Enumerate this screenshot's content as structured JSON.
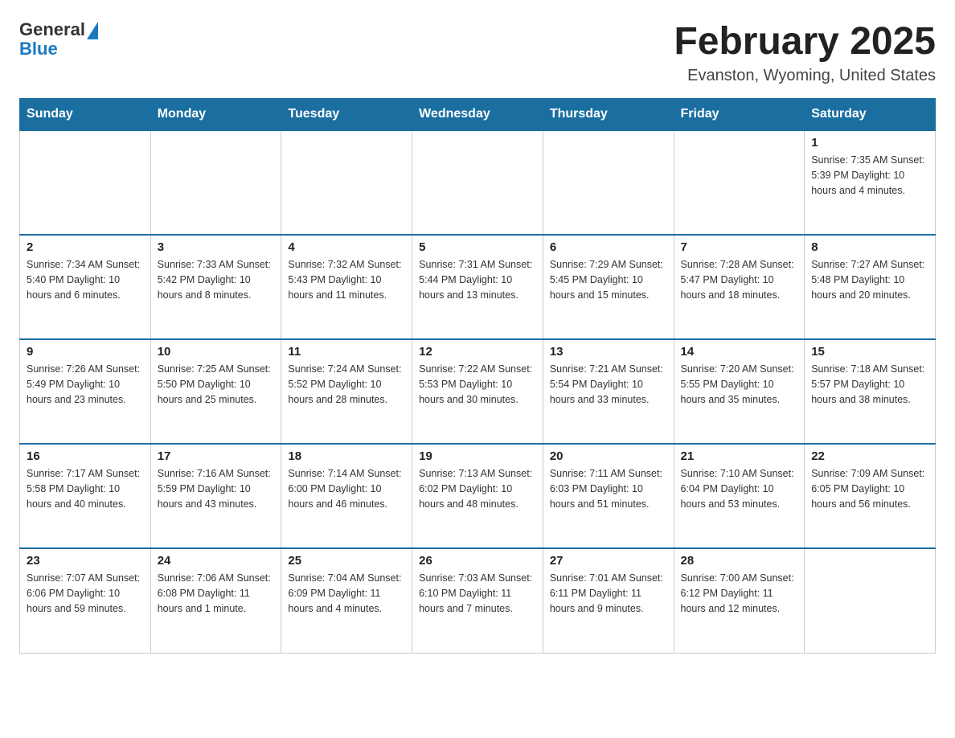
{
  "header": {
    "logo_general": "General",
    "logo_blue": "Blue",
    "title": "February 2025",
    "subtitle": "Evanston, Wyoming, United States"
  },
  "calendar": {
    "days_of_week": [
      "Sunday",
      "Monday",
      "Tuesday",
      "Wednesday",
      "Thursday",
      "Friday",
      "Saturday"
    ],
    "weeks": [
      [
        {
          "day": null,
          "info": null
        },
        {
          "day": null,
          "info": null
        },
        {
          "day": null,
          "info": null
        },
        {
          "day": null,
          "info": null
        },
        {
          "day": null,
          "info": null
        },
        {
          "day": null,
          "info": null
        },
        {
          "day": "1",
          "info": "Sunrise: 7:35 AM\nSunset: 5:39 PM\nDaylight: 10 hours and 4 minutes."
        }
      ],
      [
        {
          "day": "2",
          "info": "Sunrise: 7:34 AM\nSunset: 5:40 PM\nDaylight: 10 hours and 6 minutes."
        },
        {
          "day": "3",
          "info": "Sunrise: 7:33 AM\nSunset: 5:42 PM\nDaylight: 10 hours and 8 minutes."
        },
        {
          "day": "4",
          "info": "Sunrise: 7:32 AM\nSunset: 5:43 PM\nDaylight: 10 hours and 11 minutes."
        },
        {
          "day": "5",
          "info": "Sunrise: 7:31 AM\nSunset: 5:44 PM\nDaylight: 10 hours and 13 minutes."
        },
        {
          "day": "6",
          "info": "Sunrise: 7:29 AM\nSunset: 5:45 PM\nDaylight: 10 hours and 15 minutes."
        },
        {
          "day": "7",
          "info": "Sunrise: 7:28 AM\nSunset: 5:47 PM\nDaylight: 10 hours and 18 minutes."
        },
        {
          "day": "8",
          "info": "Sunrise: 7:27 AM\nSunset: 5:48 PM\nDaylight: 10 hours and 20 minutes."
        }
      ],
      [
        {
          "day": "9",
          "info": "Sunrise: 7:26 AM\nSunset: 5:49 PM\nDaylight: 10 hours and 23 minutes."
        },
        {
          "day": "10",
          "info": "Sunrise: 7:25 AM\nSunset: 5:50 PM\nDaylight: 10 hours and 25 minutes."
        },
        {
          "day": "11",
          "info": "Sunrise: 7:24 AM\nSunset: 5:52 PM\nDaylight: 10 hours and 28 minutes."
        },
        {
          "day": "12",
          "info": "Sunrise: 7:22 AM\nSunset: 5:53 PM\nDaylight: 10 hours and 30 minutes."
        },
        {
          "day": "13",
          "info": "Sunrise: 7:21 AM\nSunset: 5:54 PM\nDaylight: 10 hours and 33 minutes."
        },
        {
          "day": "14",
          "info": "Sunrise: 7:20 AM\nSunset: 5:55 PM\nDaylight: 10 hours and 35 minutes."
        },
        {
          "day": "15",
          "info": "Sunrise: 7:18 AM\nSunset: 5:57 PM\nDaylight: 10 hours and 38 minutes."
        }
      ],
      [
        {
          "day": "16",
          "info": "Sunrise: 7:17 AM\nSunset: 5:58 PM\nDaylight: 10 hours and 40 minutes."
        },
        {
          "day": "17",
          "info": "Sunrise: 7:16 AM\nSunset: 5:59 PM\nDaylight: 10 hours and 43 minutes."
        },
        {
          "day": "18",
          "info": "Sunrise: 7:14 AM\nSunset: 6:00 PM\nDaylight: 10 hours and 46 minutes."
        },
        {
          "day": "19",
          "info": "Sunrise: 7:13 AM\nSunset: 6:02 PM\nDaylight: 10 hours and 48 minutes."
        },
        {
          "day": "20",
          "info": "Sunrise: 7:11 AM\nSunset: 6:03 PM\nDaylight: 10 hours and 51 minutes."
        },
        {
          "day": "21",
          "info": "Sunrise: 7:10 AM\nSunset: 6:04 PM\nDaylight: 10 hours and 53 minutes."
        },
        {
          "day": "22",
          "info": "Sunrise: 7:09 AM\nSunset: 6:05 PM\nDaylight: 10 hours and 56 minutes."
        }
      ],
      [
        {
          "day": "23",
          "info": "Sunrise: 7:07 AM\nSunset: 6:06 PM\nDaylight: 10 hours and 59 minutes."
        },
        {
          "day": "24",
          "info": "Sunrise: 7:06 AM\nSunset: 6:08 PM\nDaylight: 11 hours and 1 minute."
        },
        {
          "day": "25",
          "info": "Sunrise: 7:04 AM\nSunset: 6:09 PM\nDaylight: 11 hours and 4 minutes."
        },
        {
          "day": "26",
          "info": "Sunrise: 7:03 AM\nSunset: 6:10 PM\nDaylight: 11 hours and 7 minutes."
        },
        {
          "day": "27",
          "info": "Sunrise: 7:01 AM\nSunset: 6:11 PM\nDaylight: 11 hours and 9 minutes."
        },
        {
          "day": "28",
          "info": "Sunrise: 7:00 AM\nSunset: 6:12 PM\nDaylight: 11 hours and 12 minutes."
        },
        {
          "day": null,
          "info": null
        }
      ]
    ]
  }
}
